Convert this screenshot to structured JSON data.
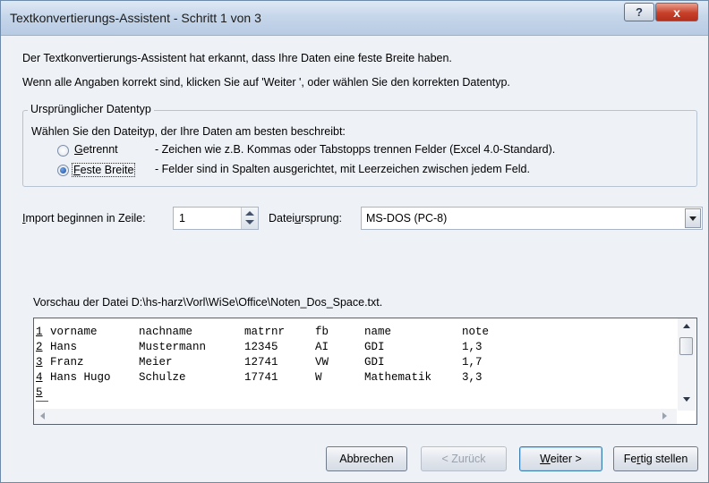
{
  "window": {
    "title": "Textkonvertierungs-Assistent - Schritt 1 von 3",
    "help_label": "?",
    "close_label": "x"
  },
  "intro": {
    "line1": "Der Textkonvertierungs-Assistent hat erkannt, dass Ihre Daten eine feste Breite haben.",
    "line2": "Wenn alle Angaben korrekt sind, klicken Sie auf 'Weiter ', oder wählen Sie den korrekten Datentyp."
  },
  "datatype_group": {
    "label": "Ursprünglicher Datentyp",
    "prompt": "Wählen Sie den Dateityp, der Ihre Daten am besten beschreibt:",
    "options": [
      {
        "hotkey": "G",
        "rest": "etrennt",
        "description": "- Zeichen wie z.B. Kommas oder Tabstopps trennen Felder (Excel 4.0-Standard).",
        "selected": false
      },
      {
        "hotkey": "F",
        "rest": "este Breite",
        "description": "- Felder sind in Spalten ausgerichtet, mit Leerzeichen zwischen jedem Feld.",
        "selected": true
      }
    ]
  },
  "import_row": {
    "label_hotkey": "I",
    "label_rest": "mport beginnen in Zeile:",
    "value": "1"
  },
  "origin": {
    "label_pre": "Datei",
    "label_hotkey": "u",
    "label_post": "rsprung:",
    "value": "MS-DOS (PC-8)"
  },
  "preview": {
    "label": "Vorschau der Datei D:\\hs-harz\\Vorl\\WiSe\\Office\\Noten_Dos_Space.txt.",
    "rows": [
      {
        "num": "1",
        "cells": [
          "vorname",
          "nachname",
          "matrnr",
          "fb",
          "name",
          "note"
        ]
      },
      {
        "num": "2",
        "cells": [
          "Hans",
          "Mustermann",
          "12345",
          "AI",
          "GDI",
          "1,3"
        ]
      },
      {
        "num": "3",
        "cells": [
          "Franz",
          "Meier",
          "12741",
          "VW",
          "GDI",
          "1,7"
        ]
      },
      {
        "num": "4",
        "cells": [
          "Hans Hugo",
          "Schulze",
          "17741",
          "W",
          "Mathematik",
          "3,3"
        ]
      },
      {
        "num": "5",
        "cells": []
      }
    ]
  },
  "buttons": {
    "cancel": "Abbrechen",
    "back": "< Zurück",
    "next_hotkey": "W",
    "next_rest": "eiter >",
    "finish_pre": "Fe",
    "finish_hotkey": "r",
    "finish_post": "tig stellen"
  }
}
